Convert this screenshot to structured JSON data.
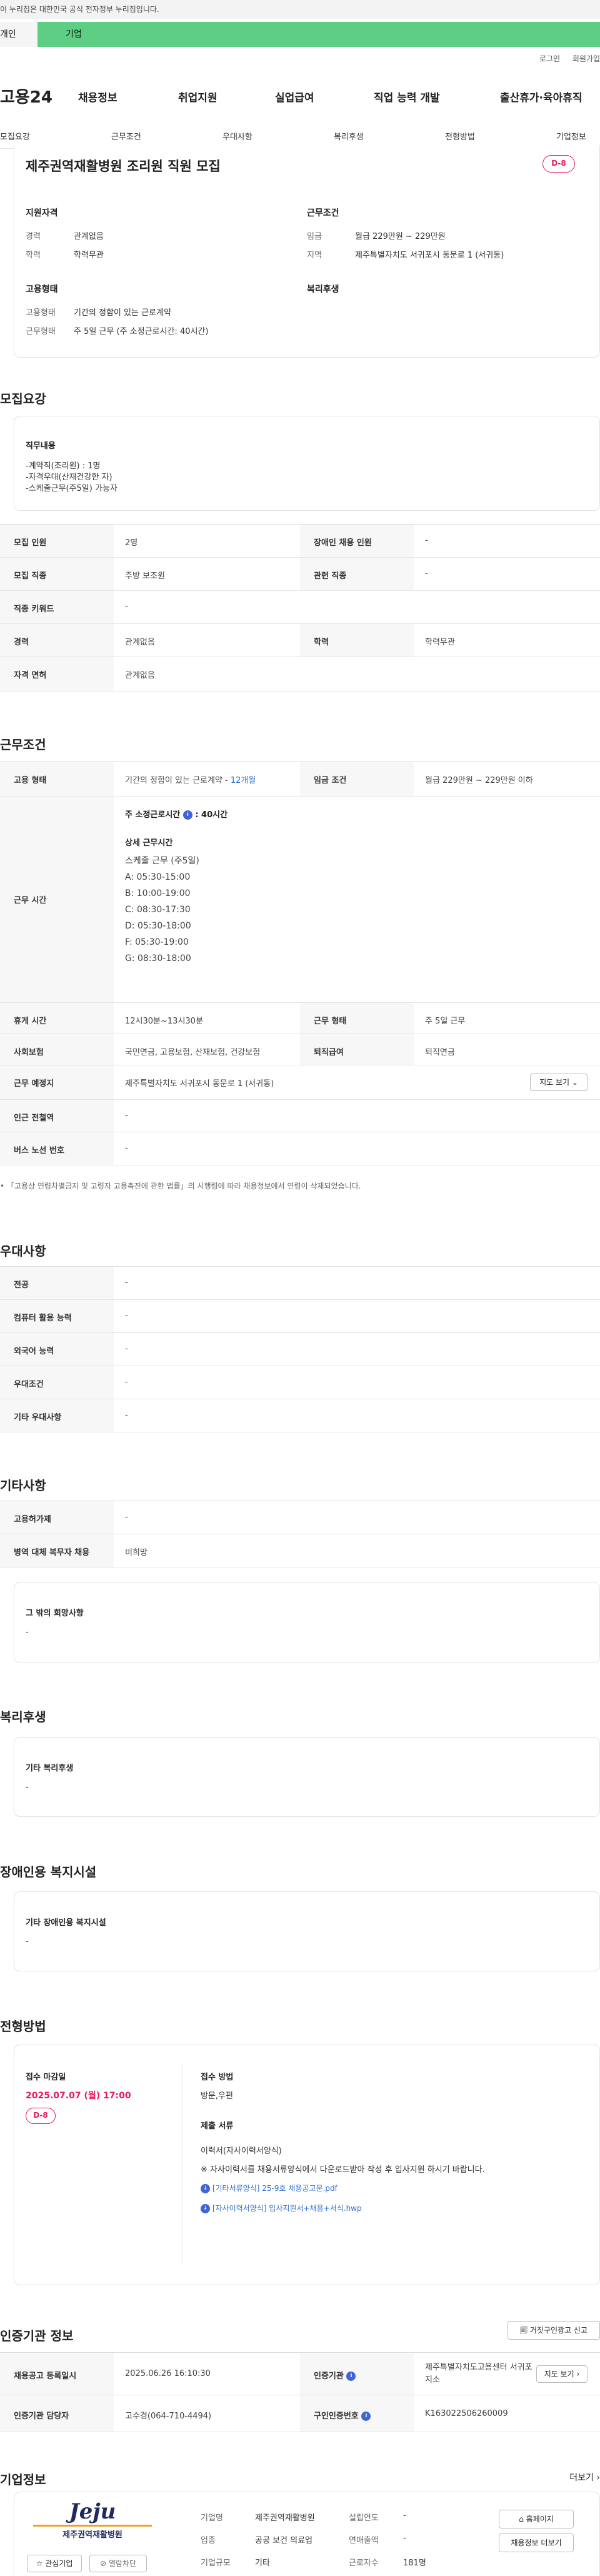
{
  "gov_banner": "이 누리집은 대한민국 공식 전자정부 누리집입니다.",
  "top_tabs": {
    "personal": "개인",
    "company": "기업"
  },
  "util": {
    "login": "로그인",
    "join": "회원가입"
  },
  "logo": "고용24",
  "gnb": [
    "채용정보",
    "취업지원",
    "실업급여",
    "직업 능력 개발",
    "출산휴가·육아휴직"
  ],
  "snb": [
    "모집요강",
    "근무조건",
    "우대사항",
    "복리후생",
    "전형방법",
    "기업정보"
  ],
  "summary": {
    "title": "제주권역재활병원 조리원 직원 모집",
    "dday": "D-8",
    "qual_title": "지원자격",
    "career_label": "경력",
    "career": "관계없음",
    "edu_label": "학력",
    "edu": "학력무관",
    "cond_title": "근무조건",
    "wage_label": "임금",
    "wage": "월급 229만원 ~ 229만원",
    "region_label": "지역",
    "region": "제주특별자치도 서귀포시 동문로 1 (서귀동)",
    "emp_title": "고용형태",
    "emp_type_label": "고용형태",
    "emp_type": "기간의 정함이 있는 근로계약",
    "work_form_label": "근무형태",
    "work_form": "주 5일 근무 (주 소정근로시간: 40시간)",
    "welfare_title": "복리후생"
  },
  "recruit": {
    "heading": "모집요강",
    "duty_title": "직무내용",
    "duty_lines": [
      "-계약직(조리원) : 1명",
      "-자격우대(산재건강한 자)",
      "-스케줄근무(주5일) 가능자"
    ],
    "rows": [
      {
        "k1": "모집 인원",
        "v1": "2명",
        "k2": "장애인 채용 인원",
        "v2": "-"
      },
      {
        "k1": "모집 직종",
        "v1": "주방 보조원",
        "k2": "관련 직종",
        "v2": "-"
      },
      {
        "k1": "직종 키워드",
        "v1": "-"
      },
      {
        "k1": "경력",
        "v1": "관계없음",
        "k2": "학력",
        "v2": "학력무관"
      },
      {
        "k1": "자격 면허",
        "v1": "관계없음"
      }
    ]
  },
  "condition": {
    "heading": "근무조건",
    "emp_label": "고용 형태",
    "emp_value": "기간의 정함이 있는 근로계약 -",
    "emp_months": "12개월",
    "wage_label": "임금 조건",
    "wage_value": "월급 229만원 ~ 229만원 이하",
    "hours_label": "근무 시간",
    "hours_main": "주 소정근로시간",
    "hours_info": "i",
    "hours_value": ": 40시간",
    "hours_detail_title": "상세 근무시간",
    "hours_lines": [
      "스케줄 근무 (주5일)",
      "A: 05:30-15:00",
      "B: 10:00-19:00",
      "C: 08:30-17:30",
      "D: 05:30-18:00",
      "F: 05:30-19:00",
      "G: 08:30-18:00"
    ],
    "break_label": "휴게 시간",
    "break_value": "12시30분~13시30분",
    "form_label": "근무 형태",
    "form_value": "주 5일 근무",
    "insurance_label": "사회보험",
    "insurance_value": "국민연금, 고용보험, 산재보험, 건강보험",
    "retire_label": "퇴직급여",
    "retire_value": "퇴직연금",
    "place_label": "근무 예정지",
    "place_value": "제주특별자치도 서귀포시 동문로 1 (서귀동)",
    "map_btn": "지도 보기",
    "subway_label": "인근 전철역",
    "subway_value": "-",
    "bus_label": "버스 노선 번호",
    "bus_value": "-",
    "footnote": "「고용상 연령차별금지 및 고령자 고용촉진에 관한 법률」의 시행령에 따라 채용정보에서 연령이 삭제되었습니다."
  },
  "preference": {
    "heading": "우대사항",
    "rows": [
      {
        "k": "전공",
        "v": "-"
      },
      {
        "k": "컴퓨터 활용 능력",
        "v": "-"
      },
      {
        "k": "외국어 능력",
        "v": "-"
      },
      {
        "k": "우대조건",
        "v": "-"
      },
      {
        "k": "기타 우대사항",
        "v": "-"
      }
    ]
  },
  "other": {
    "heading": "기타사항",
    "rows": [
      {
        "k": "고용허가제",
        "v": "-"
      },
      {
        "k": "병역 대체 복무자 채용",
        "v": "비희망"
      }
    ],
    "extra_title": "그 밖의 희망사항",
    "extra_value": "-"
  },
  "welfare": {
    "heading": "복리후생",
    "box_title": "기타 복리후생",
    "box_value": "-"
  },
  "disability": {
    "heading": "장애인용 복지시설",
    "box_title": "기타 장애인용 복지시설",
    "box_value": "-"
  },
  "selection": {
    "heading": "전형방법",
    "deadline_title": "접수 마감일",
    "deadline": "2025.07.07 (월) 17:00",
    "dday": "D-8",
    "method_title": "접수 방법",
    "method": "방문,우편",
    "docs_title": "제출 서류",
    "docs_value": "이력서(자사이력서양식)",
    "docs_note": "※ 자사이력서를 채용서류양식에서 다운로드받아 작성 후 입사지원 하시기 바랍니다.",
    "files": [
      "[기타서류양식] 25-9호 채용공고문.pdf",
      "[자사이력서양식] 입사지원서+채용+서식.hwp"
    ]
  },
  "cert": {
    "heading": "인증기관 정보",
    "report_btn": "거짓구인광고 신고",
    "reg_label": "채용공고 등록일시",
    "reg_value": "2025.06.26 16:10:30",
    "org_label": "인증기관",
    "org_value": "제주특별자치도고용센터 서귀포지소",
    "map_btn": "지도 보기",
    "staff_label": "인증기관 담당자",
    "staff_value": "고수경(064-710-4494)",
    "no_label": "구인인증번호",
    "no_value": "K163022506260009"
  },
  "company": {
    "heading": "기업정보",
    "more": "더보기",
    "logo_text": "Jeju",
    "logo_sub": "제주권역재활병원",
    "name_label": "기업명",
    "name": "제주권역재활병원",
    "biz_label": "업종",
    "biz": "공공 보건 의료업",
    "size_label": "기업규모",
    "size": "기타",
    "founded_label": "설립연도",
    "founded": "-",
    "sales_label": "연매출액",
    "sales": "-",
    "emp_label": "근로자수",
    "emp": "181명",
    "homepage_btn": "홈페이지",
    "list_btn": "채용정보 더보기",
    "fav_btn": "관심기업",
    "block_btn": "열람차단"
  },
  "colors": {
    "accent": "#5fce85",
    "dday": "#e5195e",
    "link": "#2f6fd1"
  }
}
